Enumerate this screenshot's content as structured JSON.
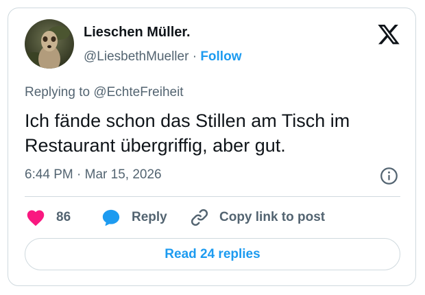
{
  "author": {
    "display_name": "Lieschen Müller.",
    "handle": "@LiesbethMueller",
    "separator": "·",
    "follow_label": "Follow"
  },
  "post": {
    "replying_prefix": "Replying to",
    "replying_to": "@EchteFreiheit",
    "text": "Ich fände schon das Stillen am Tisch im Restaurant übergriffig, aber gut.",
    "timestamp": "6:44 PM · Mar 15, 2026"
  },
  "actions": {
    "like_count": "86",
    "reply_label": "Reply",
    "copy_label": "Copy link to post",
    "read_replies_label": "Read 24 replies"
  },
  "icons": {
    "logo": "x-logo-icon",
    "info": "info-icon",
    "like": "heart-icon",
    "reply": "speech-bubble-icon",
    "copy": "link-icon"
  },
  "colors": {
    "accent": "#1d9bf0",
    "like": "#f91880",
    "text": "#0f1419",
    "secondary": "#536471",
    "border": "#cfd9de"
  }
}
